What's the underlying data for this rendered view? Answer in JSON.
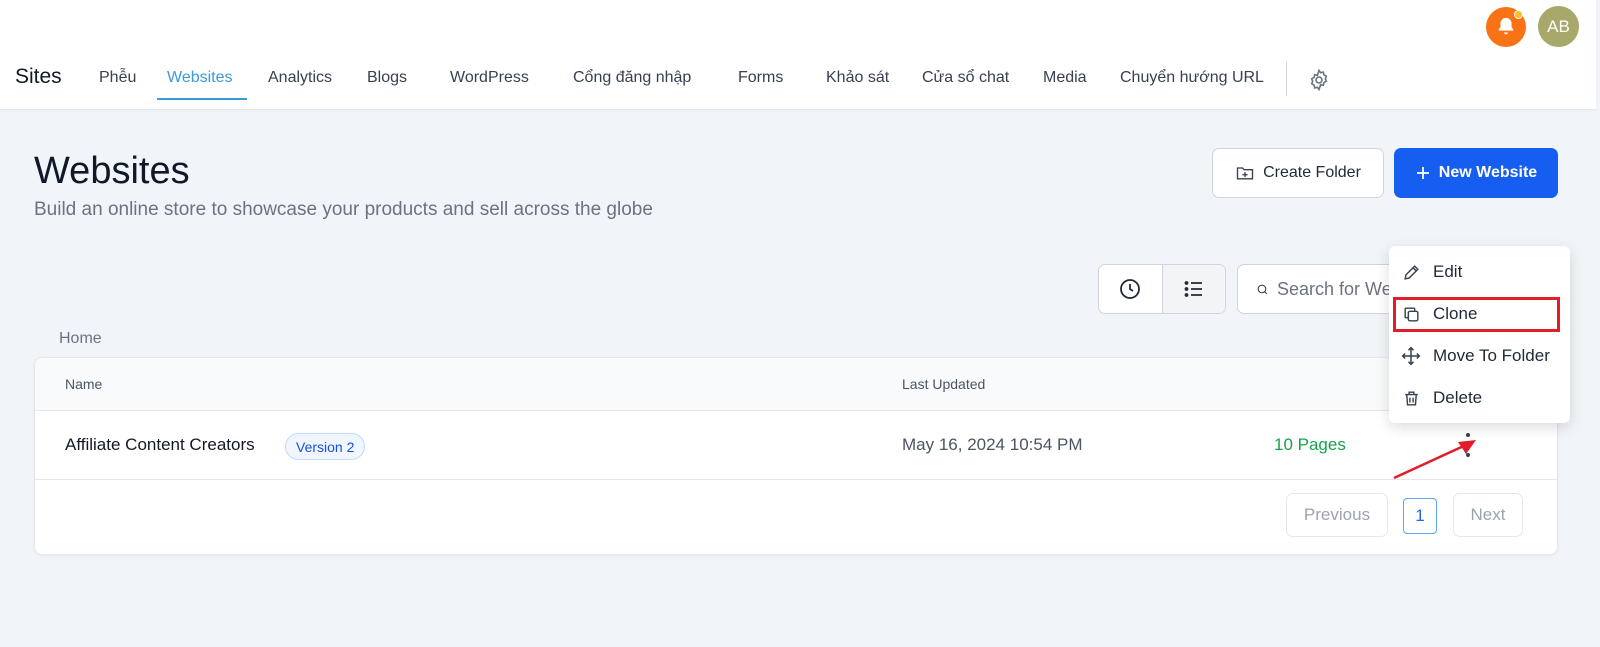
{
  "header": {
    "brand": "Sites",
    "nav": [
      {
        "label": "Phễu",
        "active": false
      },
      {
        "label": "Websites",
        "active": true
      },
      {
        "label": "Analytics",
        "active": false
      },
      {
        "label": "Blogs",
        "active": false
      },
      {
        "label": "WordPress",
        "active": false
      },
      {
        "label": "Cổng đăng nhập",
        "active": false
      },
      {
        "label": "Forms",
        "active": false
      },
      {
        "label": "Khảo sát",
        "active": false
      },
      {
        "label": "Cửa sổ chat",
        "active": false
      },
      {
        "label": "Media",
        "active": false
      },
      {
        "label": "Chuyển hướng URL",
        "active": false
      }
    ],
    "avatar_initials": "AB",
    "icons": {
      "notifications": "bell-icon",
      "settings": "gear-icon"
    }
  },
  "page": {
    "title": "Websites",
    "subtitle": "Build an online store to showcase your products and sell across the globe",
    "create_folder_label": "Create Folder",
    "new_website_label": "New Website"
  },
  "toolbar": {
    "search_placeholder": "Search for Websites",
    "view_modes": [
      "recent",
      "list"
    ],
    "active_view": "list"
  },
  "breadcrumb": "Home",
  "table": {
    "columns": [
      "Name",
      "Last Updated"
    ],
    "rows": [
      {
        "name": "Affiliate Content Creators",
        "badge": "Version 2",
        "last_updated": "May 16, 2024 10:54 PM",
        "pages": "10 Pages"
      }
    ]
  },
  "pagination": {
    "previous": "Previous",
    "current": "1",
    "next": "Next"
  },
  "context_menu": {
    "items": [
      {
        "label": "Edit",
        "icon": "pencil-icon"
      },
      {
        "label": "Clone",
        "icon": "copy-icon",
        "highlighted": true
      },
      {
        "label": "Move To Folder",
        "icon": "move-icon"
      },
      {
        "label": "Delete",
        "icon": "trash-icon"
      }
    ]
  },
  "colors": {
    "accent": "#3b9ad9",
    "primary_button": "#155eef",
    "pages_count": "#16a34a",
    "highlight_box": "#e11d2a",
    "bell_bg": "#f97316"
  }
}
